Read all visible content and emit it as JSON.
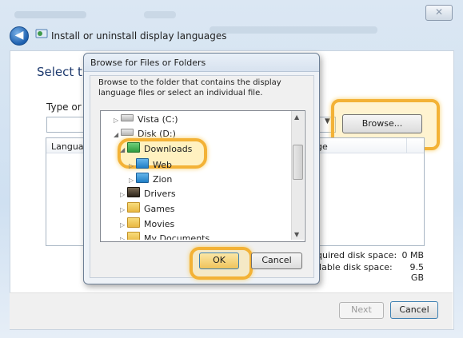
{
  "wizard": {
    "title": "Install or uninstall display languages",
    "heading": "Select the",
    "type_label": "Type or br",
    "browse_label": "Browse...",
    "list_columns": [
      "Language",
      "ge"
    ],
    "required_space_label": "quired disk space:",
    "required_space_value": "0 MB",
    "available_space_label": "ilable disk space:",
    "available_space_value": "9.5 GB",
    "next_label": "Next",
    "cancel_label": "Cancel"
  },
  "dialog": {
    "title": "Browse for Files or Folders",
    "description": "Browse to the folder that contains the display language files or select an individual file.",
    "tree": [
      {
        "label": "Vista (C:)",
        "icon": "drive-icon"
      },
      {
        "label": "Disk (D:)",
        "icon": "drive-icon"
      },
      {
        "label": "Downloads",
        "icon": "downloads-folder-icon"
      },
      {
        "label": "Web",
        "icon": "folder-icon"
      },
      {
        "label": "Zion",
        "icon": "folder-icon"
      },
      {
        "label": "Drivers",
        "icon": "folder-icon"
      },
      {
        "label": "Games",
        "icon": "folder-icon"
      },
      {
        "label": "Movies",
        "icon": "folder-icon"
      },
      {
        "label": "My Documents",
        "icon": "folder-icon"
      }
    ],
    "ok_label": "OK",
    "cancel_label": "Cancel"
  },
  "colors": {
    "highlight": "#f3b236",
    "heading": "#1e3a6e"
  }
}
